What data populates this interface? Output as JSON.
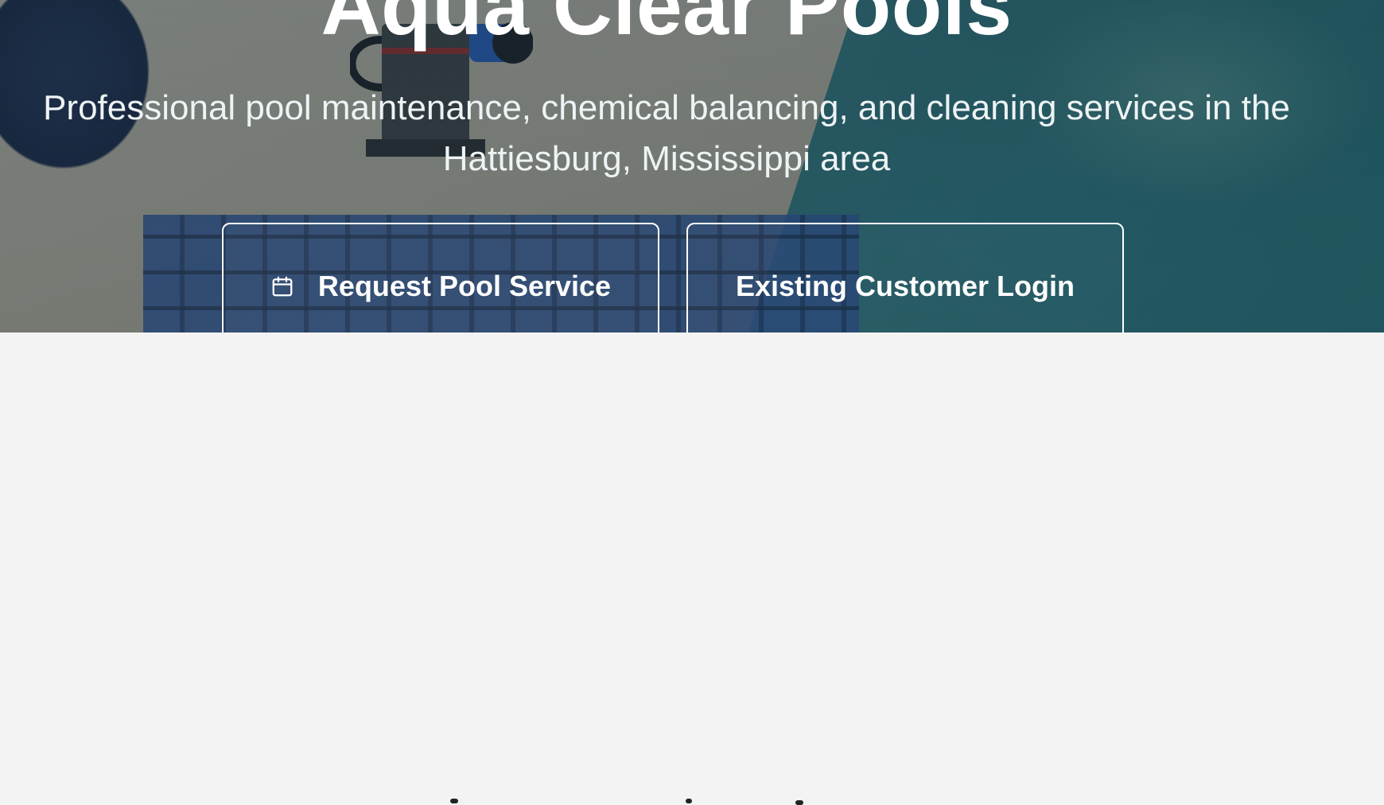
{
  "hero": {
    "title": "Aqua Clear Pools",
    "subtitle": "Professional pool maintenance, chemical balancing, and cleaning services in the Hattiesburg, Mississippi area",
    "buttons": {
      "request_service": {
        "label": "Request Pool Service",
        "icon": "calendar-icon"
      },
      "customer_login": {
        "label": "Existing Customer Login"
      }
    }
  },
  "colors": {
    "hero_text": "#ffffff",
    "page_background": "#f3f3f3",
    "pool_water": "#2f6b72"
  }
}
